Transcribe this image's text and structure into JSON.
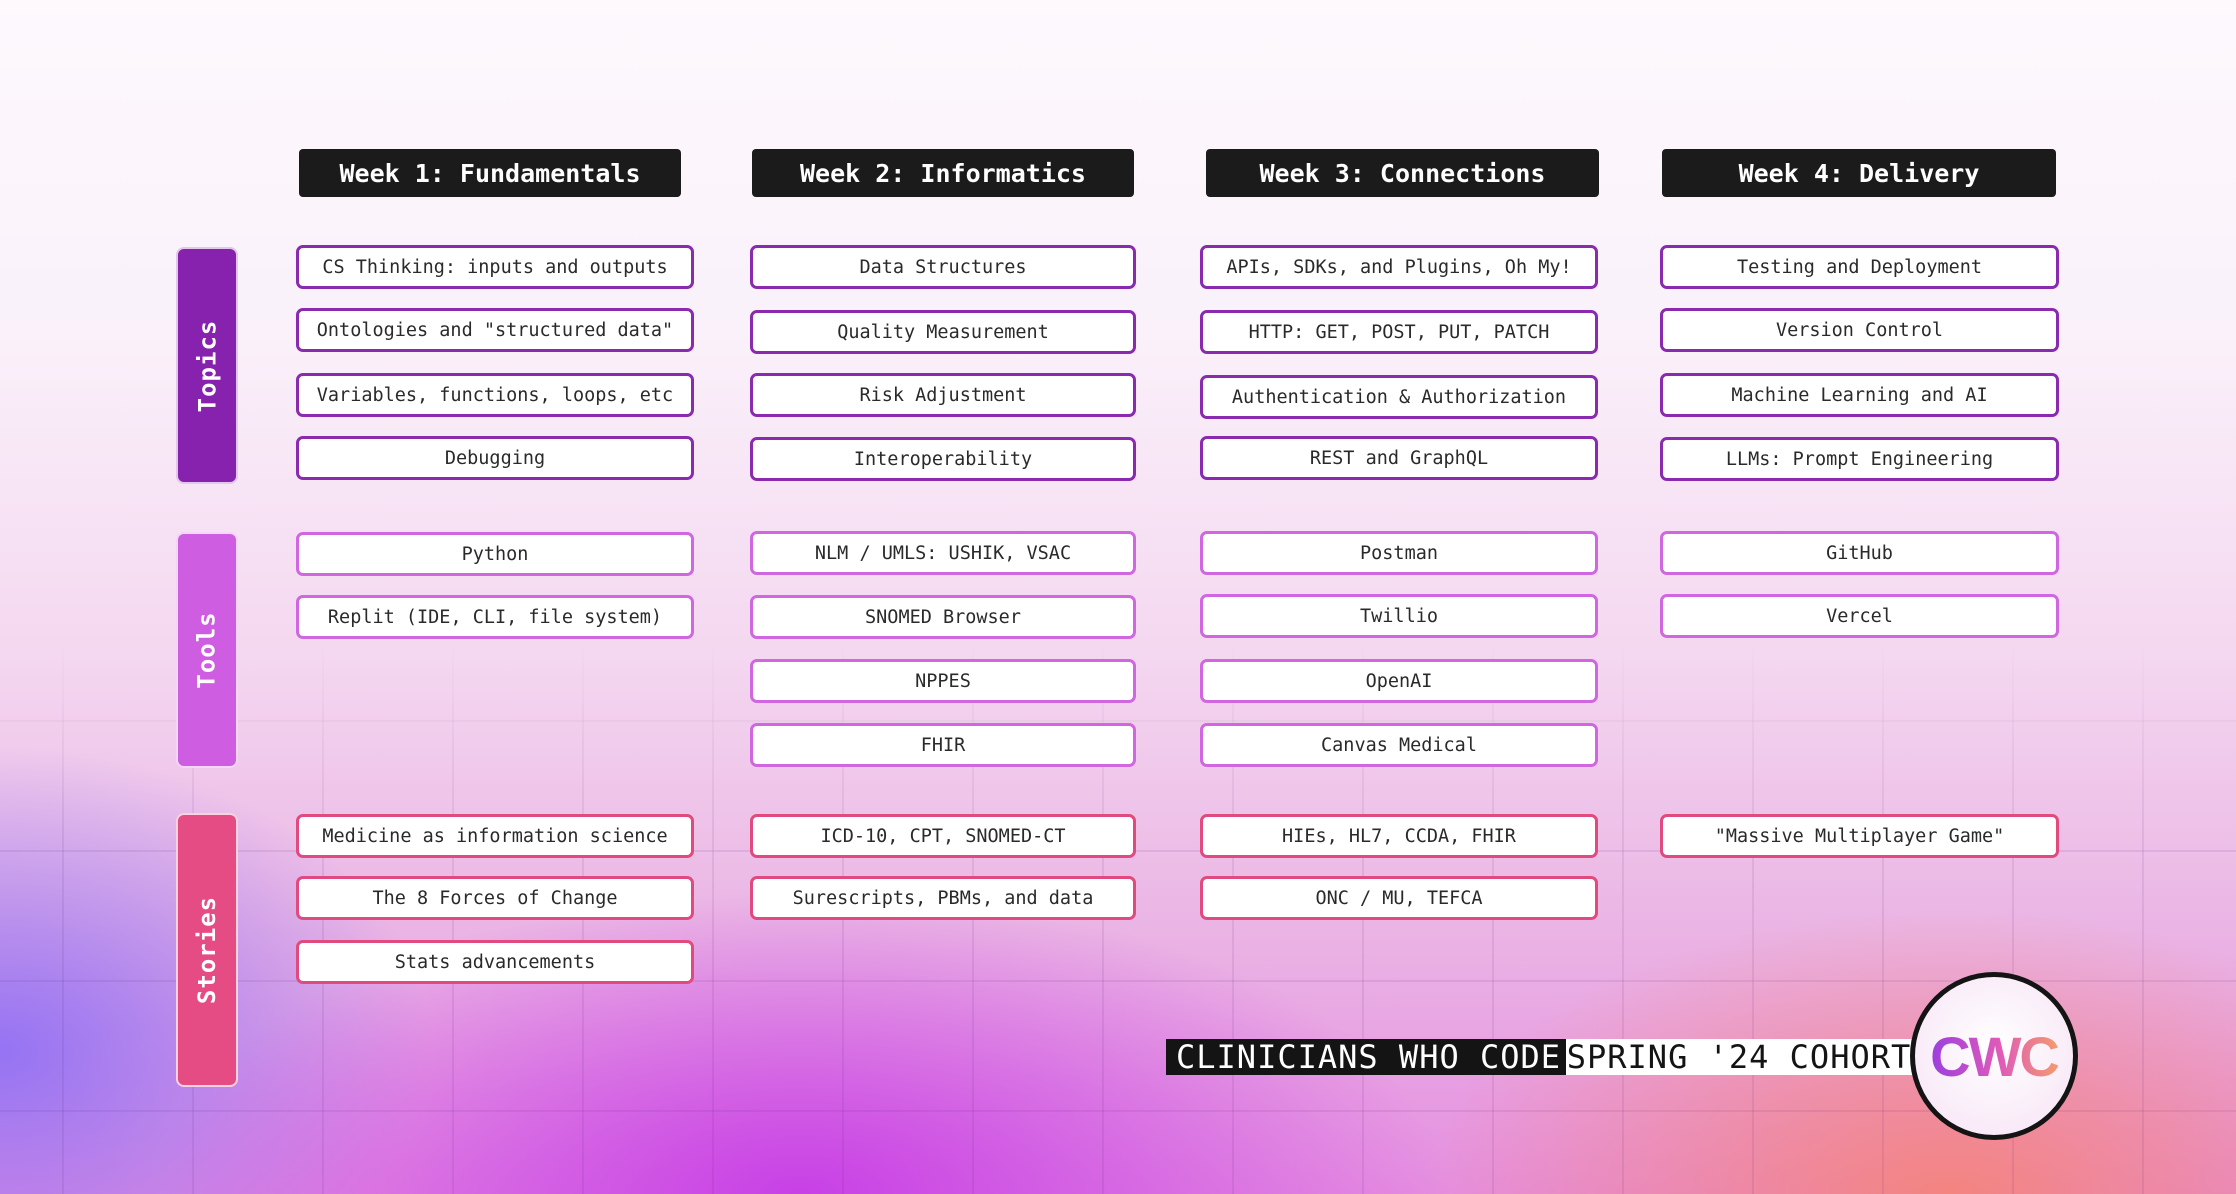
{
  "weeks": [
    {
      "title": "Week 1: Fundamentals",
      "topics": [
        "CS Thinking: inputs and outputs",
        "Ontologies and \"structured data\"",
        "Variables, functions, loops, etc",
        "Debugging"
      ],
      "tools": [
        "Python",
        "Replit (IDE, CLI, file system)"
      ],
      "stories": [
        "Medicine as information science",
        "The 8 Forces of Change",
        "Stats advancements"
      ]
    },
    {
      "title": "Week 2: Informatics",
      "topics": [
        "Data Structures",
        "Quality Measurement",
        "Risk Adjustment",
        "Interoperability"
      ],
      "tools": [
        "NLM / UMLS: USHIK, VSAC",
        "SNOMED Browser",
        "NPPES",
        "FHIR"
      ],
      "stories": [
        "ICD-10, CPT, SNOMED-CT",
        "Surescripts, PBMs, and data"
      ]
    },
    {
      "title": "Week 3: Connections",
      "topics": [
        "APIs, SDKs, and Plugins, Oh My!",
        "HTTP: GET, POST, PUT, PATCH",
        "Authentication & Authorization",
        "REST and GraphQL"
      ],
      "tools": [
        "Postman",
        "Twillio",
        "OpenAI",
        "Canvas Medical"
      ],
      "stories": [
        "HIEs, HL7, CCDA, FHIR",
        "ONC / MU, TEFCA"
      ]
    },
    {
      "title": "Week 4: Delivery",
      "topics": [
        "Testing and Deployment",
        "Version Control",
        "Machine Learning and AI",
        "LLMs: Prompt Engineering"
      ],
      "tools": [
        "GitHub",
        "Vercel"
      ],
      "stories": [
        "\"Massive Multiplayer Game\""
      ]
    }
  ],
  "row_labels": {
    "topics": "Topics",
    "tools": "Tools",
    "stories": "Stories"
  },
  "footer": {
    "program": "CLINICIANS WHO CODE",
    "cohort": "SPRING '24 COHORT",
    "logo_text": "CWC"
  },
  "colors": {
    "topics": "#8622ad",
    "tools": "#cf5de2",
    "stories": "#e54c84",
    "header_bg": "#1b1b1b"
  }
}
